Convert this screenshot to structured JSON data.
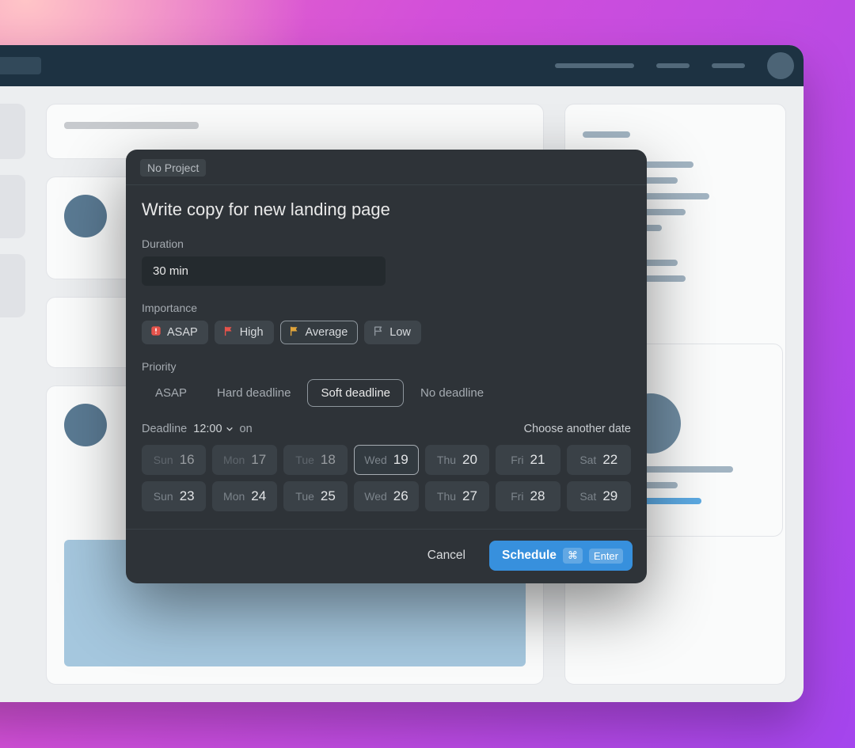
{
  "modal": {
    "project_chip": "No Project",
    "title": "Write copy for new landing page",
    "duration_label": "Duration",
    "duration_value": "30 min",
    "importance_label": "Importance",
    "importance_options": [
      {
        "label": "ASAP",
        "color": "#e5534b",
        "icon": "alert",
        "selected": false
      },
      {
        "label": "High",
        "color": "#e5534b",
        "icon": "flag",
        "selected": false
      },
      {
        "label": "Average",
        "color": "#e0a43a",
        "icon": "flag",
        "selected": true
      },
      {
        "label": "Low",
        "color": "#8d959c",
        "icon": "flag-o",
        "selected": false
      }
    ],
    "priority_label": "Priority",
    "priority_options": [
      {
        "label": "ASAP",
        "selected": false
      },
      {
        "label": "Hard deadline",
        "selected": false
      },
      {
        "label": "Soft deadline",
        "selected": true
      },
      {
        "label": "No deadline",
        "selected": false
      }
    ],
    "deadline_label": "Deadline",
    "deadline_time": "12:00",
    "deadline_on": "on",
    "choose_another": "Choose another date",
    "dates": [
      {
        "dow": "Sun",
        "num": "16",
        "past": true,
        "selected": false
      },
      {
        "dow": "Mon",
        "num": "17",
        "past": true,
        "selected": false
      },
      {
        "dow": "Tue",
        "num": "18",
        "past": true,
        "selected": false
      },
      {
        "dow": "Wed",
        "num": "19",
        "past": false,
        "selected": true
      },
      {
        "dow": "Thu",
        "num": "20",
        "past": false,
        "selected": false
      },
      {
        "dow": "Fri",
        "num": "21",
        "past": false,
        "selected": false
      },
      {
        "dow": "Sat",
        "num": "22",
        "past": false,
        "selected": false
      },
      {
        "dow": "Sun",
        "num": "23",
        "past": false,
        "selected": false
      },
      {
        "dow": "Mon",
        "num": "24",
        "past": false,
        "selected": false
      },
      {
        "dow": "Tue",
        "num": "25",
        "past": false,
        "selected": false
      },
      {
        "dow": "Wed",
        "num": "26",
        "past": false,
        "selected": false
      },
      {
        "dow": "Thu",
        "num": "27",
        "past": false,
        "selected": false
      },
      {
        "dow": "Fri",
        "num": "28",
        "past": false,
        "selected": false
      },
      {
        "dow": "Sat",
        "num": "29",
        "past": false,
        "selected": false
      }
    ],
    "cancel_label": "Cancel",
    "schedule_label": "Schedule",
    "shortcut_mod": "⌘",
    "shortcut_key": "Enter"
  }
}
